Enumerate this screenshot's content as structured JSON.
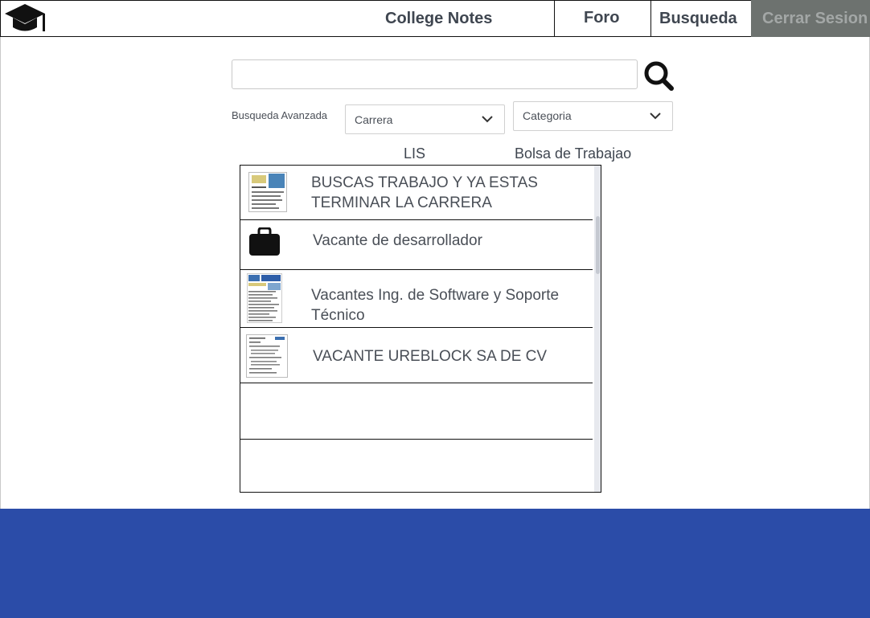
{
  "header": {
    "brand": "College Notes",
    "nav": {
      "foro": "Foro",
      "busqueda": "Busqueda",
      "logout": "Cerrar Sesion"
    },
    "logout_bg": "#6d726f"
  },
  "search": {
    "value": "",
    "placeholder": ""
  },
  "filters": {
    "advanced_label": "Busqueda Avanzada",
    "carrera": "Carrera",
    "categoria": "Categoria",
    "selected_carrera": "LIS",
    "selected_categoria": "Bolsa de Trabajao"
  },
  "results": [
    {
      "title": "BUSCAS TRABAJO Y YA ESTAS TERMINAR LA CARRERA",
      "icon": "document-thumbnail"
    },
    {
      "title": "Vacante de desarrollador",
      "icon": "briefcase-icon"
    },
    {
      "title": "Vacantes Ing. de Software y Soporte Técnico",
      "icon": "document-thumbnail"
    },
    {
      "title": "VACANTE UREBLOCK SA DE CV",
      "icon": "document-thumbnail"
    },
    {
      "title": ""
    },
    {
      "title": ""
    }
  ],
  "colors": {
    "footer": "#2b4ca8",
    "text": "#4a4f57"
  }
}
